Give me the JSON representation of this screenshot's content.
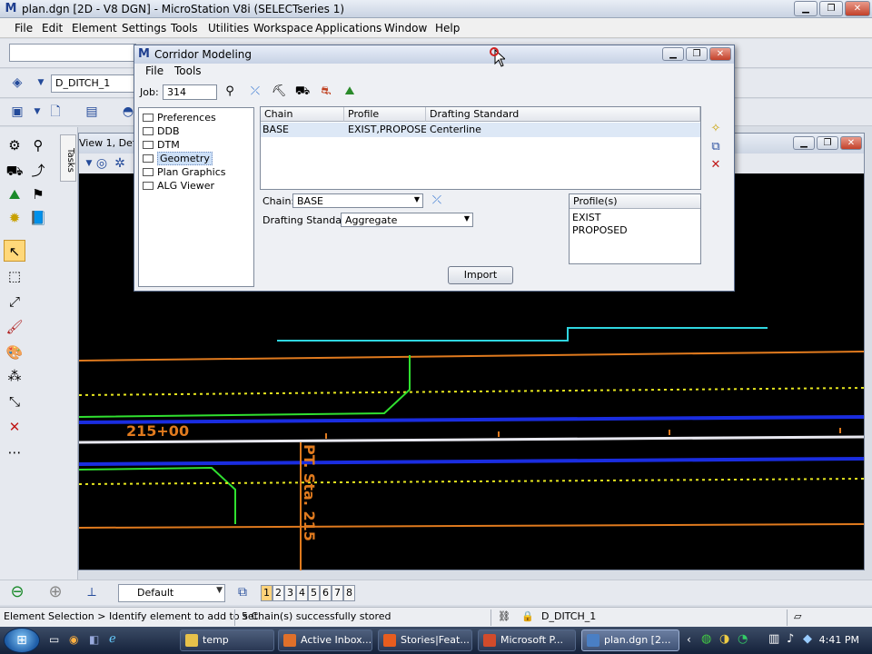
{
  "app": {
    "title": "plan.dgn [2D - V8 DGN] - MicroStation V8i (SELECTseries 1)",
    "icon": "microstation-icon"
  },
  "menu": [
    {
      "label": "File"
    },
    {
      "label": "Edit"
    },
    {
      "label": "Element"
    },
    {
      "label": "Settings"
    },
    {
      "label": "Tools"
    },
    {
      "label": "Utilities"
    },
    {
      "label": "Workspace"
    },
    {
      "label": "Applications"
    },
    {
      "label": "Window"
    },
    {
      "label": "Help"
    }
  ],
  "toolbar": {
    "level_combo": "D_DITCH_1"
  },
  "view": {
    "title": "View 1, Defau"
  },
  "tasks_tab": "Tasks",
  "canvas": {
    "label_station": "215+00",
    "label_pt": "PT. Sta. 215"
  },
  "bottom": {
    "view_attr_combo": "Default",
    "view_numbers": [
      "1",
      "2",
      "3",
      "4",
      "5",
      "6",
      "7",
      "8"
    ]
  },
  "status": {
    "prompt": "Element Selection > Identify element to add to set",
    "message": "5 Chain(s) successfully stored",
    "level": "D_DITCH_1"
  },
  "taskbar": {
    "tasks": [
      {
        "label": "temp",
        "color": "#e7c14a"
      },
      {
        "label": "Active Inbox...",
        "color": "#e0702a"
      },
      {
        "label": "Stories|Feat...",
        "color": "#e85d1f"
      },
      {
        "label": "Microsoft P...",
        "color": "#d24b2b"
      },
      {
        "label": "plan.dgn [2...",
        "color": "#4a7fc4"
      }
    ],
    "clock": "4:41 PM"
  },
  "dialog": {
    "title": "Corridor Modeling",
    "menu": [
      {
        "label": "File"
      },
      {
        "label": "Tools"
      }
    ],
    "job_label": "Job:",
    "job_value": "314",
    "tree": [
      "Preferences",
      "DDB",
      "DTM",
      "Geometry",
      "Plan Graphics",
      "ALG Viewer"
    ],
    "tree_selected": 3,
    "grid": {
      "headers": [
        "Chain",
        "Profile",
        "Drafting Standard"
      ],
      "rows": [
        {
          "chain": "BASE",
          "profile": "EXIST,PROPOSED",
          "standard": "Centerline"
        }
      ]
    },
    "chain_label": "Chain:",
    "chain_value": "BASE",
    "drafting_label": "Drafting Standard:",
    "drafting_value": "Aggregate",
    "profiles_header": "Profile(s)",
    "profiles": [
      "EXIST",
      "PROPOSED"
    ],
    "import_button": "Import"
  }
}
